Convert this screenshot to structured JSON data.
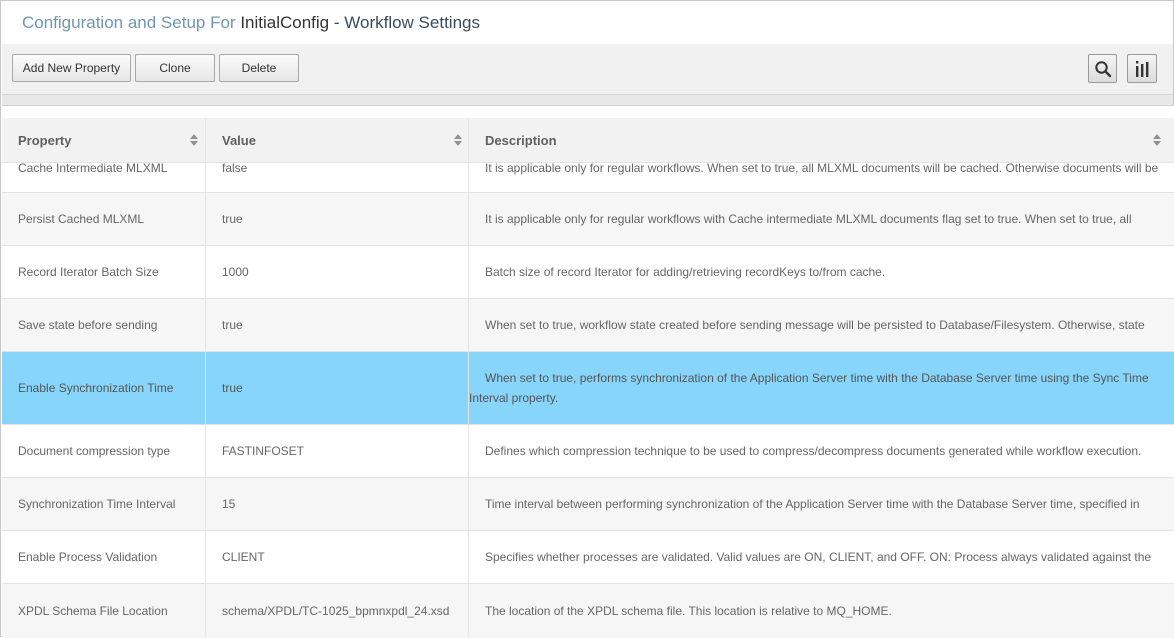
{
  "title": {
    "prefix": "Configuration and Setup For ",
    "config": "InitialConfig",
    "suffix": " - Workflow Settings"
  },
  "toolbar": {
    "add_label": "Add New Property",
    "clone_label": "Clone",
    "delete_label": "Delete",
    "search_icon": "search-icon",
    "columns_icon": "columns-icon"
  },
  "table": {
    "columns": [
      "Property",
      "Value",
      "Description"
    ],
    "rows": [
      {
        "property": "Cache Intermediate MLXML",
        "value": "false",
        "description": "It is applicable only for regular workflows. When set to true, all MLXML documents will be cached. Otherwise documents will be"
      },
      {
        "property": "Persist Cached MLXML",
        "value": "true",
        "description": "It is applicable only for regular workflows with Cache intermediate MLXML documents flag set to true. When set to true, all"
      },
      {
        "property": "Record Iterator Batch Size",
        "value": "1000",
        "description": "Batch size of record Iterator for adding/retrieving recordKeys to/from cache."
      },
      {
        "property": "Save state before sending",
        "value": "true",
        "description": "When set to true, workflow state created before sending message will be persisted to Database/Filesystem. Otherwise, state"
      },
      {
        "property": "Enable Synchronization Time",
        "value": "true",
        "description": "When set to true, performs synchronization of the Application Server time with the Database Server time using the Sync Time Interval property."
      },
      {
        "property": "Document compression type",
        "value": "FASTINFOSET",
        "description": "Defines which compression technique to be used to compress/decompress documents generated while workflow execution."
      },
      {
        "property": "Synchronization Time Interval",
        "value": "15",
        "description": "Time interval between performing synchronization of the Application Server time with the Database Server time, specified in"
      },
      {
        "property": "Enable Process Validation",
        "value": "CLIENT",
        "description": "Specifies whether processes are validated. Valid values are ON, CLIENT, and OFF. ON: Process always validated against the"
      },
      {
        "property": "XPDL Schema File Location",
        "value": "schema/XPDL/TC-1025_bpmnxpdl_24.xsd",
        "description": "The location of the XPDL schema file. This location is relative to MQ_HOME."
      }
    ]
  },
  "colors": {
    "selected_row": "#87d5fb",
    "title_prefix": "#6f98ae"
  }
}
